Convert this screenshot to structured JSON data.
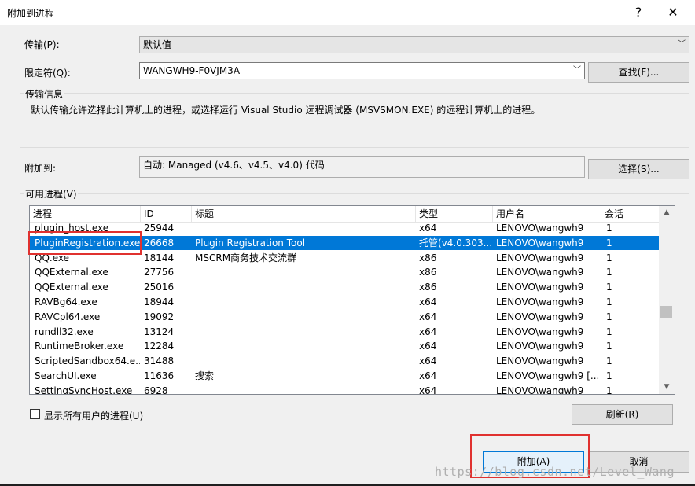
{
  "window": {
    "title": "附加到进程",
    "help_glyph": "?",
    "close_glyph": "✕"
  },
  "transport": {
    "label": "传输(P):",
    "value": "默认值"
  },
  "qualifier": {
    "label": "限定符(Q):",
    "value": "WANGWH9-F0VJM3A",
    "find_button": "查找(F)..."
  },
  "transport_info": {
    "label": "传输信息",
    "text": "默认传输允许选择此计算机上的进程，或选择运行 Visual Studio 远程调试器 (MSVSMON.EXE) 的远程计算机上的进程。"
  },
  "attach_to": {
    "label": "附加到:",
    "value": "自动: Managed (v4.6、v4.5、v4.0) 代码",
    "select_button": "选择(S)..."
  },
  "processes": {
    "label": "可用进程(V)",
    "columns": [
      "进程",
      "ID",
      "标题",
      "类型",
      "用户名",
      "会话"
    ],
    "rows": [
      {
        "name": "plugin_host.exe",
        "id": "25944",
        "title": "",
        "type": "x64",
        "user": "LENOVO\\wangwh9",
        "session": "1",
        "selected": false
      },
      {
        "name": "PluginRegistration.exe",
        "id": "26668",
        "title": "Plugin Registration Tool",
        "type": "托管(v4.0.303...",
        "user": "LENOVO\\wangwh9",
        "session": "1",
        "selected": true
      },
      {
        "name": "QQ.exe",
        "id": "18144",
        "title": "MSCRM商务技术交流群",
        "type": "x86",
        "user": "LENOVO\\wangwh9",
        "session": "1",
        "selected": false
      },
      {
        "name": "QQExternal.exe",
        "id": "27756",
        "title": "",
        "type": "x86",
        "user": "LENOVO\\wangwh9",
        "session": "1",
        "selected": false
      },
      {
        "name": "QQExternal.exe",
        "id": "25016",
        "title": "",
        "type": "x86",
        "user": "LENOVO\\wangwh9",
        "session": "1",
        "selected": false
      },
      {
        "name": "RAVBg64.exe",
        "id": "18944",
        "title": "",
        "type": "x64",
        "user": "LENOVO\\wangwh9",
        "session": "1",
        "selected": false
      },
      {
        "name": "RAVCpl64.exe",
        "id": "19092",
        "title": "",
        "type": "x64",
        "user": "LENOVO\\wangwh9",
        "session": "1",
        "selected": false
      },
      {
        "name": "rundll32.exe",
        "id": "13124",
        "title": "",
        "type": "x64",
        "user": "LENOVO\\wangwh9",
        "session": "1",
        "selected": false
      },
      {
        "name": "RuntimeBroker.exe",
        "id": "12284",
        "title": "",
        "type": "x64",
        "user": "LENOVO\\wangwh9",
        "session": "1",
        "selected": false
      },
      {
        "name": "ScriptedSandbox64.e...",
        "id": "31488",
        "title": "",
        "type": "x64",
        "user": "LENOVO\\wangwh9",
        "session": "1",
        "selected": false
      },
      {
        "name": "SearchUI.exe",
        "id": "11636",
        "title": "搜索",
        "type": "x64",
        "user": "LENOVO\\wangwh9 [...",
        "session": "1",
        "selected": false
      },
      {
        "name": "SettingSyncHost.exe",
        "id": "6928",
        "title": "",
        "type": "x64",
        "user": "LENOVO\\wangwh9",
        "session": "1",
        "selected": false
      }
    ]
  },
  "show_all_users": {
    "label": "显示所有用户的进程(U)",
    "checked": false
  },
  "buttons": {
    "refresh": "刷新(R)",
    "attach": "附加(A)",
    "cancel": "取消"
  },
  "watermark": "https://blog.csdn.net/Level_Wang",
  "colors": {
    "selection": "#0078d7",
    "highlight_box": "#e0312f"
  }
}
